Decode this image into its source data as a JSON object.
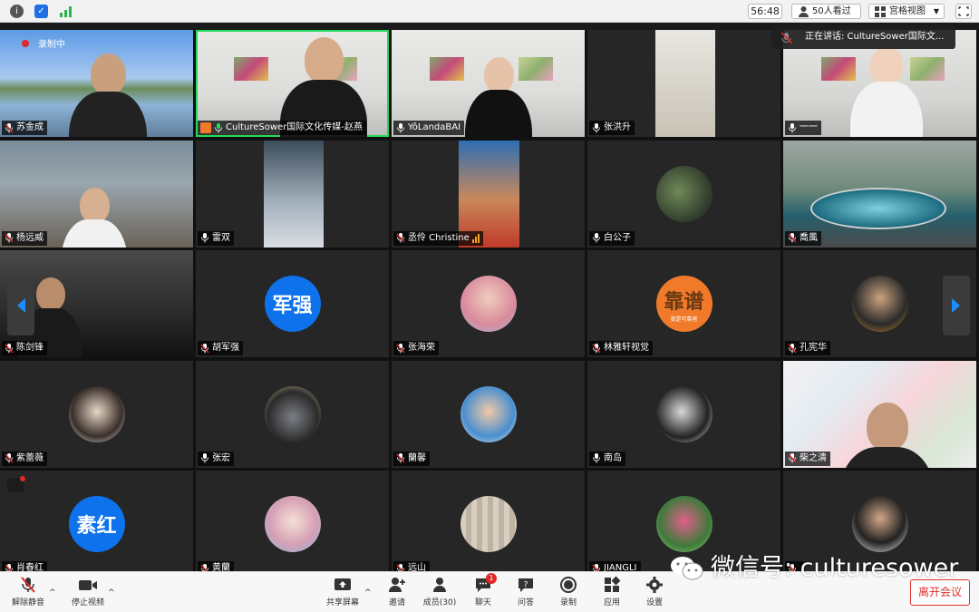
{
  "topbar": {
    "timer": "56:48",
    "viewers": "50人看过",
    "view_mode": "宫格视图",
    "icons": [
      "info-icon",
      "shield-icon",
      "signal-icon",
      "people-icon",
      "grid-icon",
      "dropdown-caret-icon",
      "fullscreen-icon"
    ]
  },
  "recording": {
    "label": "录制中",
    "color": "#e02828"
  },
  "speaking": {
    "text": "正在讲话: CultureSower国际文..."
  },
  "participants": [
    {
      "name": "苏金成",
      "mic": "muted"
    },
    {
      "name": "CultureSower国际文化传媒-赵燕",
      "mic": "on",
      "host": true,
      "active": true
    },
    {
      "name": "YôLandaBAI",
      "mic": "on"
    },
    {
      "name": "张洪升",
      "mic": "on"
    },
    {
      "name": "一一",
      "mic": "on"
    },
    {
      "name": "杨远威",
      "mic": "muted"
    },
    {
      "name": "雷双",
      "mic": "on"
    },
    {
      "name": "丞伶 Christine",
      "mic": "muted",
      "signal": true
    },
    {
      "name": "白公子",
      "mic": "on"
    },
    {
      "name": "喬風",
      "mic": "muted"
    },
    {
      "name": "陈剑锋",
      "mic": "muted"
    },
    {
      "name": "胡军强",
      "mic": "muted",
      "avatar_text": "军强"
    },
    {
      "name": "张海荣",
      "mic": "muted"
    },
    {
      "name": "林雅轩视觉",
      "mic": "muted",
      "avatar_text": "靠谱",
      "avatar_sub": "我是可靠者"
    },
    {
      "name": "孔宪华",
      "mic": "muted"
    },
    {
      "name": "紫蕾薇",
      "mic": "muted"
    },
    {
      "name": "张宏",
      "mic": "on"
    },
    {
      "name": "蘭馨",
      "mic": "muted"
    },
    {
      "name": "南岛",
      "mic": "on"
    },
    {
      "name": "柴之清",
      "mic": "muted"
    },
    {
      "name": "肖春红",
      "mic": "muted",
      "avatar_text": "素红"
    },
    {
      "name": "黄蘭",
      "mic": "muted"
    },
    {
      "name": "远山",
      "mic": "muted"
    },
    {
      "name": "JIANGLI",
      "mic": "muted"
    },
    {
      "name": "",
      "mic": "muted"
    }
  ],
  "toolbar": {
    "unmute": "解除静音",
    "stop_video": "停止视频",
    "share": "共享屏幕",
    "invite": "邀请",
    "members": "成员(30)",
    "chat": "聊天",
    "chat_badge": "1",
    "qa": "问答",
    "record": "录制",
    "apps": "应用",
    "settings": "设置",
    "leave": "离开会议",
    "leave_color": "#e0302b"
  },
  "watermark": {
    "text": "微信号: culturesower"
  },
  "colors": {
    "active_speaker": "#23d959",
    "avatar_blue": "#0e72ed",
    "avatar_orange": "#f07a2a"
  }
}
